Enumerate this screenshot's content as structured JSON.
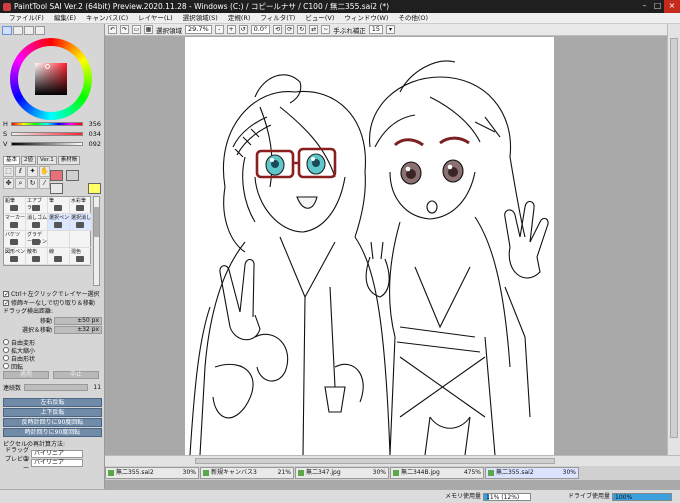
{
  "window": {
    "title": "PaintTool SAI Ver.2 (64bit) Preview.2020.11.28 - Windows (C:) / コピールナサ / C100 / 無二355.sai2 (*)"
  },
  "menu": [
    "ファイル(F)",
    "編集(E)",
    "キャンバス(C)",
    "レイヤー(L)",
    "選択領域(S)",
    "定規(R)",
    "フィルタ(T)",
    "ビュー(V)",
    "ウィンドウ(W)",
    "その他(O)"
  ],
  "toolbar": {
    "selection_label": "選択領域",
    "zoom": "29.7%",
    "angle": "0.0°",
    "stabilizer_label": "手ぶれ補正",
    "stabilizer_value": "15"
  },
  "colors": {
    "main": "#e8707a",
    "sub": "#ffff66"
  },
  "sliders": [
    {
      "label": "H",
      "value": "356",
      "fill": 0.99
    },
    {
      "label": "S",
      "value": "034",
      "fill": 0.13
    },
    {
      "label": "V",
      "value": "092",
      "fill": 0.36
    }
  ],
  "panel_tabs": [
    "基本",
    "2値",
    "Ver.1",
    "素材帳"
  ],
  "brushes": [
    "鉛筆",
    "エアブラシ",
    "筆",
    "水彩筆",
    "マーカー",
    "消しゴム",
    "選択ペン",
    "選択消し",
    "バケツ",
    "グラデーション",
    "",
    "",
    "図形ペン",
    "散布",
    "線",
    "混色"
  ],
  "options": {
    "check1": "Ctrl＋左クリックでレイヤー選択",
    "check2": "修飾キーなしで切り取り＆移動",
    "drag_threshold_label": "ドラッグ検出距離:",
    "move_label": "移動",
    "move_value": "±50 px",
    "select_move_label": "選択＆移動",
    "select_move_value": "±32 px",
    "radios": [
      "自由変形",
      "拡大縮小",
      "自由形状",
      "回転"
    ],
    "apply_label": "適用",
    "cancel_label": "中止",
    "continuous_label": "連続数",
    "continuous_value": "11",
    "flip_h": "左右反転",
    "flip_v": "上下反転",
    "rot_ccw": "反時計回りに90度回転",
    "rot_cw": "時計回りに90度回転",
    "pixel_method_label": "ピクセルの再計算方法:",
    "drag_label": "ドラッグ中",
    "drag_value": "バイリニア",
    "preview_label": "プレビュー",
    "preview_value": "バイリニア"
  },
  "files": [
    {
      "name": "無二355.sai2",
      "zoom": "30%",
      "active": false
    },
    {
      "name": "新規キャンバス3",
      "zoom": "21%",
      "active": false
    },
    {
      "name": "無二347.jpg",
      "zoom": "30%",
      "active": false
    },
    {
      "name": "無二344B.jpg",
      "zoom": "475%",
      "active": false
    },
    {
      "name": "無二355.sai2",
      "zoom": "30%",
      "active": true
    }
  ],
  "status": {
    "memory_label": "メモリ使用量",
    "memory_value": "11% (12%)",
    "memory_fill": 0.11,
    "drive_label": "ドライブ使用量",
    "drive_value": "100%",
    "drive_fill": 1.0
  }
}
